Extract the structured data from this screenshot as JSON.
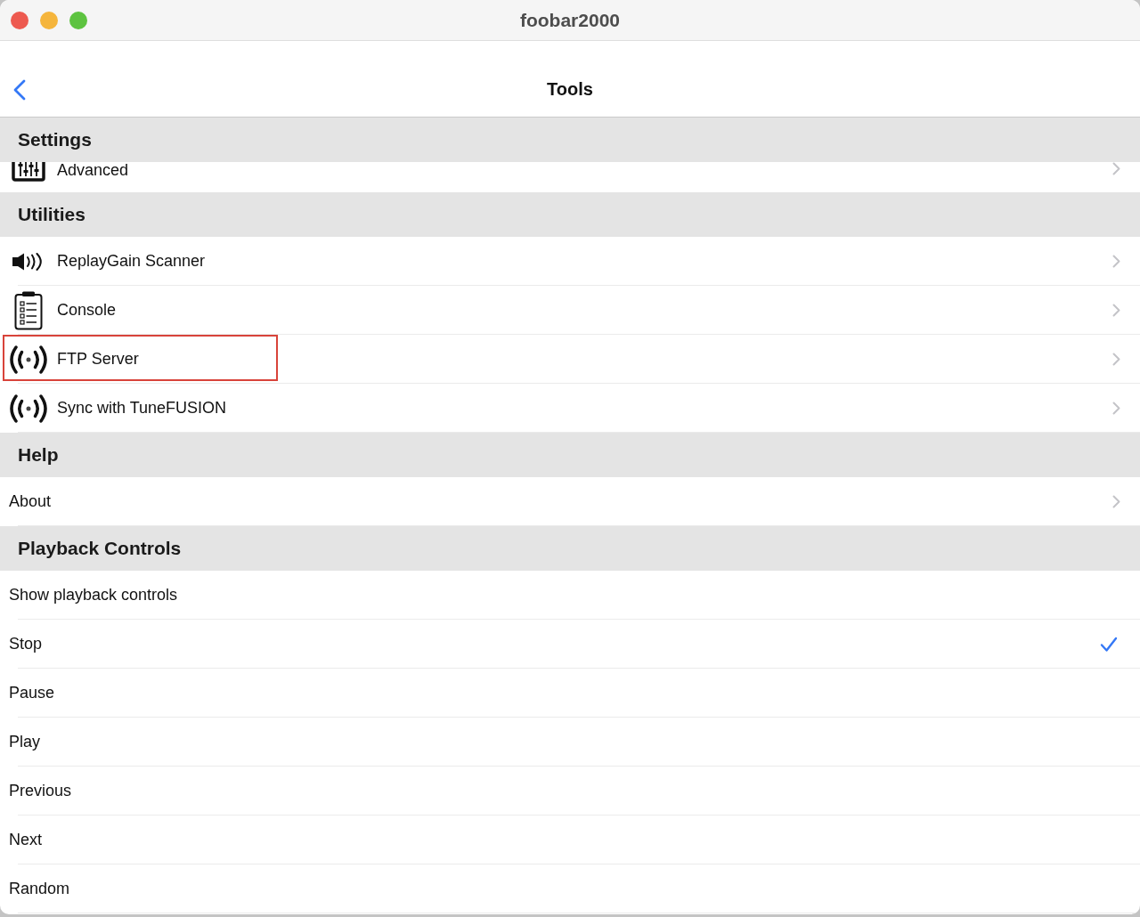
{
  "window": {
    "title": "foobar2000"
  },
  "nav": {
    "title": "Tools"
  },
  "sections": [
    {
      "title": "Settings",
      "cut_off": true,
      "items": [
        {
          "kind": "icon_link",
          "label": "Advanced",
          "highlighted": false
        }
      ]
    },
    {
      "title": "Utilities",
      "cut_off": false,
      "items": [
        {
          "kind": "icon_link",
          "label": "ReplayGain Scanner",
          "highlighted": false
        },
        {
          "kind": "icon_link",
          "label": "Console",
          "highlighted": false
        },
        {
          "kind": "icon_link",
          "label": "FTP Server",
          "highlighted": true
        },
        {
          "kind": "icon_link",
          "label": "Sync with TuneFUSION",
          "highlighted": false
        }
      ]
    },
    {
      "title": "Help",
      "cut_off": false,
      "items": [
        {
          "kind": "link",
          "label": "About",
          "highlighted": false
        }
      ]
    },
    {
      "title": "Playback Controls",
      "cut_off": false,
      "caption": "Show playback controls",
      "options": [
        {
          "label": "Stop",
          "checked": true
        },
        {
          "label": "Pause",
          "checked": false
        },
        {
          "label": "Play",
          "checked": false
        },
        {
          "label": "Previous",
          "checked": false
        },
        {
          "label": "Next",
          "checked": false
        },
        {
          "label": "Random",
          "checked": false
        }
      ]
    }
  ]
}
